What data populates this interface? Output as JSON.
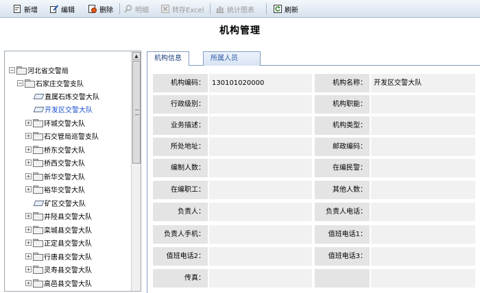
{
  "toolbar": {
    "new": "新增",
    "edit": "编辑",
    "delete": "删除",
    "detail": "明细",
    "export": "转存Excel",
    "stats": "统计图表",
    "refresh": "刷新"
  },
  "page_title": "机构管理",
  "tree": {
    "root": "河北省交警局",
    "branch": "石家庄交警支队",
    "children": [
      "直属石炼交警大队",
      "开发区交警大队",
      "环城交警大队",
      "石交管局巡警支队",
      "桥东交警大队",
      "桥西交警大队",
      "新华交警大队",
      "裕华交警大队",
      "矿区交警大队",
      "井陉县交警大队",
      "栾城县交警大队",
      "正定县交警大队",
      "行唐县交警大队",
      "灵寿县交警大队",
      "高邑县交警大队"
    ],
    "selected": "开发区交警大队"
  },
  "tabs": {
    "info": "机构信息",
    "staff": "所属人员"
  },
  "form": {
    "org_code_label": "机构编码：",
    "org_code_value": "130101020000",
    "org_name_label": "机构名称：",
    "org_name_value": "开发区交警大队",
    "admin_level_label": "行政级别：",
    "admin_level_value": "",
    "function_label": "机构职能：",
    "function_value": "",
    "business_label": "业务描述：",
    "business_value": "",
    "type_label": "机构类型：",
    "type_value": "",
    "address_label": "所处地址：",
    "address_value": "",
    "postcode_label": "邮政编码：",
    "postcode_value": "",
    "quota_label": "编制人数：",
    "quota_value": "",
    "police_label": "在编民警：",
    "police_value": "",
    "staff_label": "在编职工：",
    "staff_value": "",
    "others_label": "其他人数：",
    "others_value": "",
    "manager_label": "负责人：",
    "manager_value": "",
    "manager_phone_label": "负责人电话：",
    "manager_phone_value": "",
    "manager_mobile_label": "负责人手机：",
    "manager_mobile_value": "",
    "duty1_label": "值班电话1：",
    "duty1_value": "",
    "duty2_label": "值班电话2：",
    "duty2_value": "",
    "duty3_label": "值班电话3：",
    "duty3_value": "",
    "fax_label": "传真：",
    "fax_value": ""
  }
}
